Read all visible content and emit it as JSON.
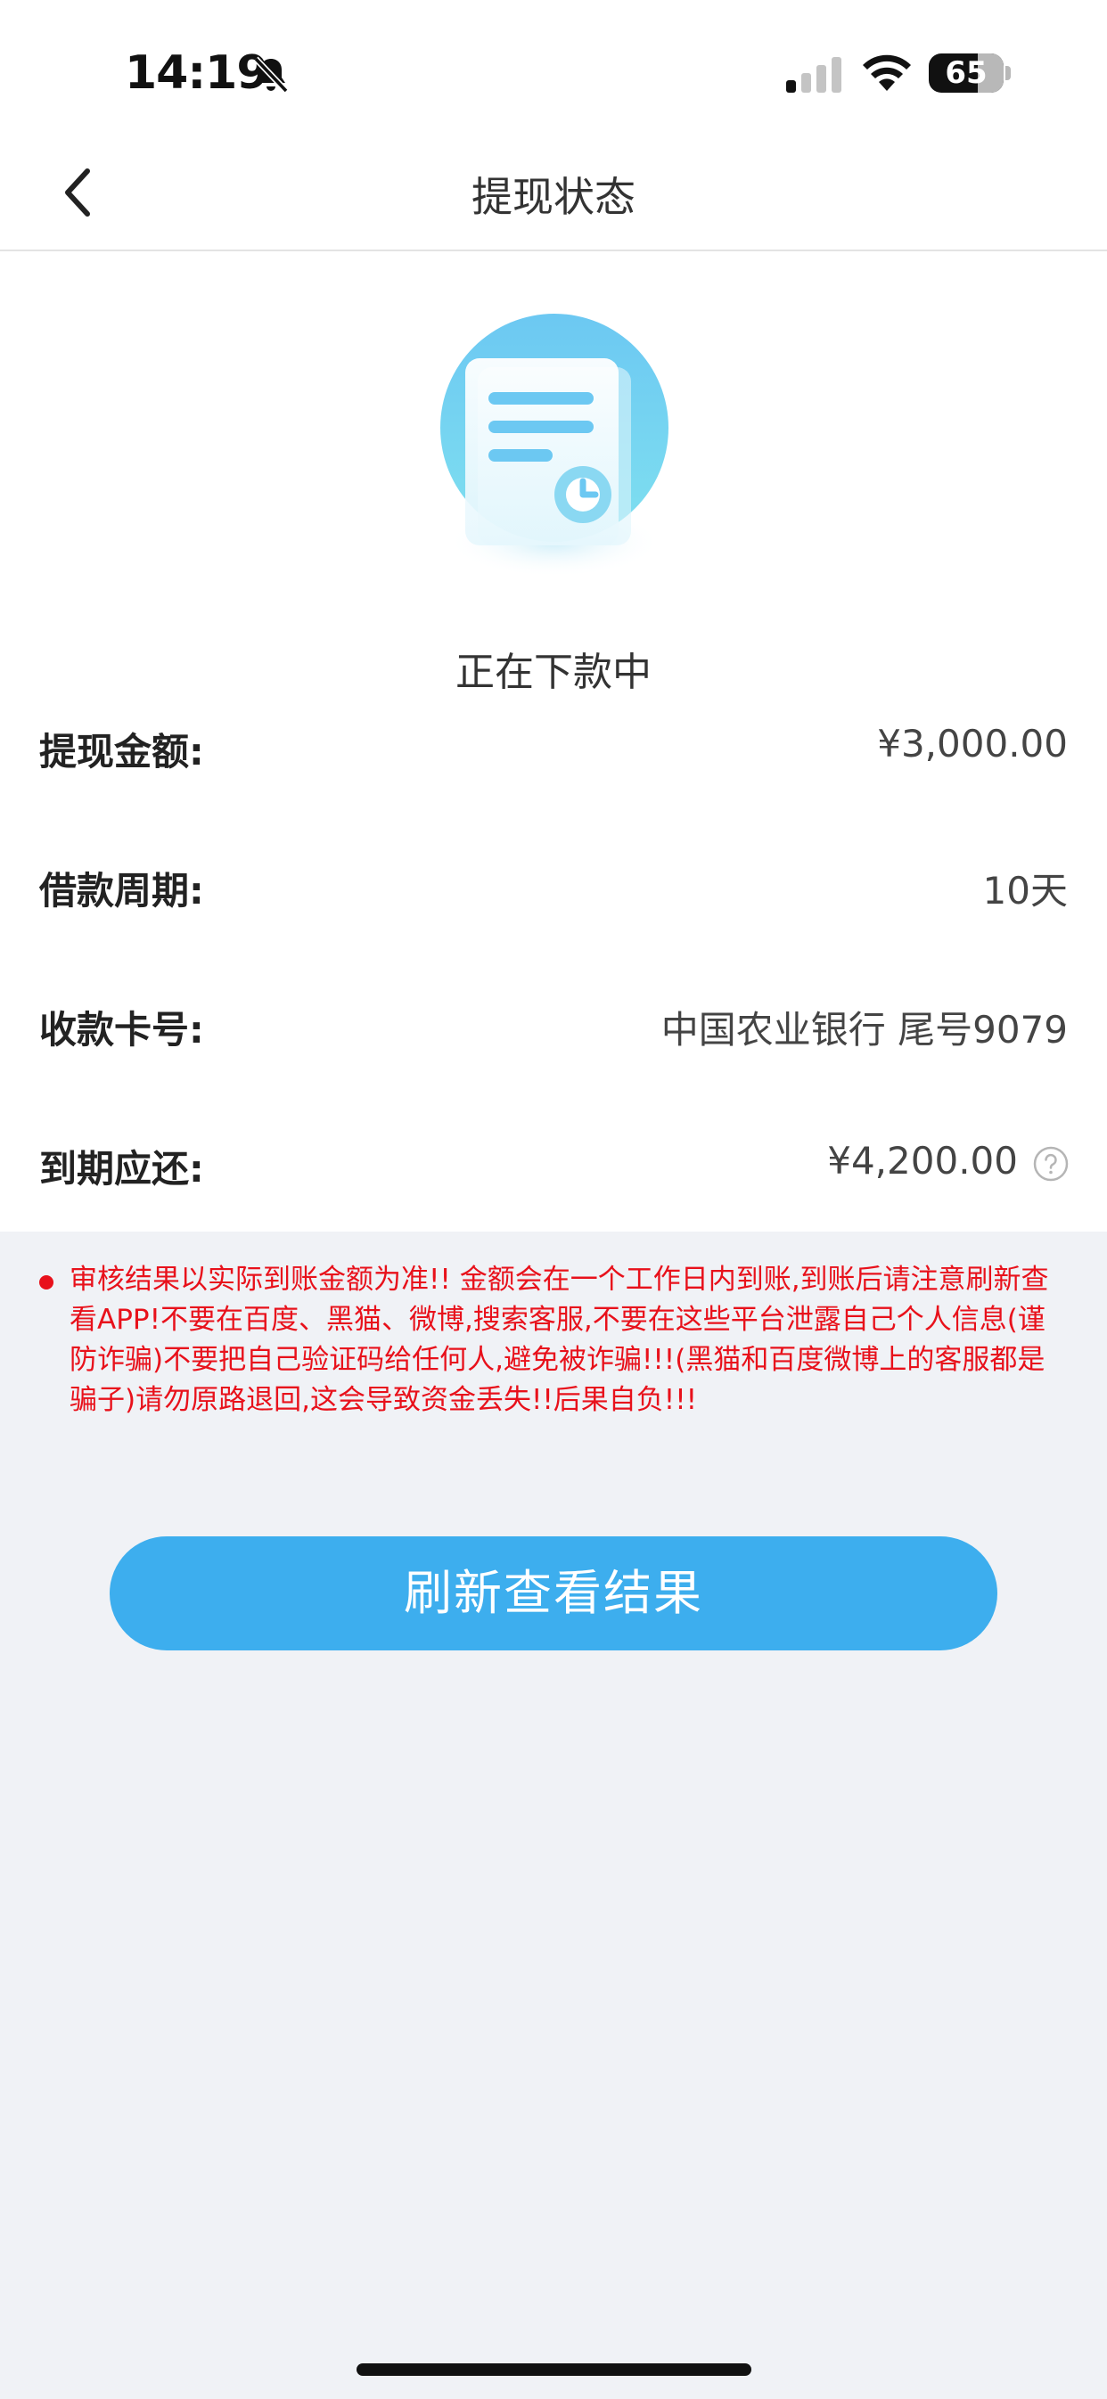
{
  "status_bar": {
    "time": "14:19",
    "battery_level": "65",
    "battery_fraction": 0.65,
    "icons": [
      "bell-muted-icon",
      "signal-icon",
      "wifi-icon",
      "battery-icon"
    ]
  },
  "nav": {
    "back_icon": "chevron-left-icon",
    "title": "提现状态"
  },
  "status": {
    "illustration_icon": "document-clock-icon",
    "text": "正在下款中"
  },
  "details": [
    {
      "label": "提现金额:",
      "value": "¥3,000.00"
    },
    {
      "label": "借款周期:",
      "value": "10天"
    },
    {
      "label": "收款卡号:",
      "value": "中国农业银行 尾号9079"
    },
    {
      "label": "到期应还:",
      "value": "¥4,200.00",
      "icon": "help-circle-icon"
    }
  ],
  "notice": {
    "text": "审核结果以实际到账金额为准!! 金额会在一个工作日内到账,到账后请注意刷新查看APP!不要在百度、黑猫、微博,搜索客服,不要在这些平台泄露自己个人信息(谨防诈骗)不要把自己验证码给任何人,避免被诈骗!!!(黑猫和百度微博上的客服都是骗子)请勿原路退回,这会导致资金丢失!!后果自负!!!"
  },
  "refresh_button": {
    "label": "刷新查看结果"
  },
  "colors": {
    "accent": "#3daeee",
    "warning": "#e8111b",
    "background": "#f0f2f6"
  }
}
